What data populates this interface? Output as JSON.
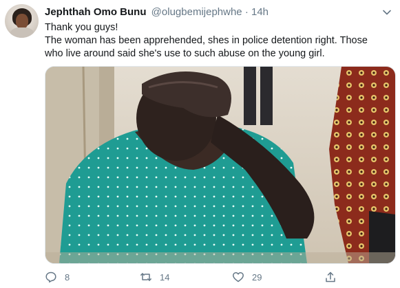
{
  "tweet": {
    "display_name": "Jephthah Omo Bunu",
    "handle": "@olugbemijephwhe",
    "separator": "·",
    "time": "14h",
    "text_lines": [
      "Thank you guys!",
      "The woman has been apprehended,  shes in police detention right. Those",
      "who live around said she's use to such abuse on the young girl."
    ],
    "actions": {
      "reply_count": "8",
      "retweet_count": "14",
      "like_count": "29"
    },
    "icons": {
      "more": "chevron-down-icon",
      "reply": "reply-icon",
      "retweet": "retweet-icon",
      "like": "heart-icon",
      "share": "share-icon"
    },
    "colors": {
      "text": "#14171a",
      "secondary": "#657786",
      "border": "#e1e8ed"
    }
  }
}
